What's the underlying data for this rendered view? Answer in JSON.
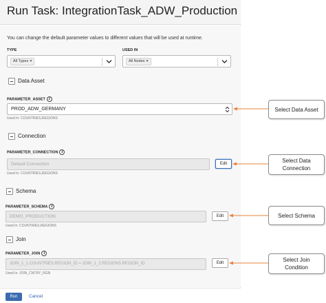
{
  "dialog": {
    "title": "Run Task: IntegrationTask_ADW_Production",
    "intro": "You can change the default parameter values to different values that will be used at runtime."
  },
  "filters": {
    "type_label": "TYPE",
    "type_chip": "All Types",
    "used_in_label": "USED IN",
    "used_in_chip": "All Nodes",
    "chip_remove": "×"
  },
  "sections": {
    "data_asset": {
      "title": "Data Asset",
      "param_label": "PARAMETER_ASSET",
      "value": "PROD_ADW_GERMANY",
      "used_in": "Used In: COUNTRIES,REGIONS"
    },
    "connection": {
      "title": "Connection",
      "param_label": "PARAMETER_CONNECTION",
      "placeholder": "Default Connection",
      "used_in": "Used In: COUNTRIES,REGIONS",
      "edit_label": "Edit"
    },
    "schema": {
      "title": "Schema",
      "param_label": "PARAMETER_SCHEMA",
      "value": "DEMO_PRODUCTION",
      "used_in": "Used In: COUNTRIES,REGIONS",
      "edit_label": "Edit"
    },
    "join": {
      "title": "Join",
      "param_label": "PARAMETER_JOIN",
      "value": "JOIN_1_1.COUNTRIES.REGION_ID = JOIN_1_2.REGIONS.REGION_ID",
      "used_in": "Used In: JOIN_CNTRY_RGN",
      "edit_label": "Edit"
    }
  },
  "footer": {
    "run_label": "Run",
    "cancel_label": "Cancel"
  },
  "callouts": {
    "data_asset": "Select Data Asset",
    "connection": "Select Data Connection",
    "schema": "Select Schema",
    "join": "Select Join Condition"
  },
  "info_glyph": "i",
  "colors": {
    "primary": "#3b6bb0",
    "arrow": "#e8833a",
    "link": "#2b5fa8"
  },
  "icons": {
    "dropdown": "chevron-down-icon",
    "stepper": "up-down-arrows-icon",
    "info": "info-icon",
    "section_toggle": "collapse-minus-icon"
  }
}
